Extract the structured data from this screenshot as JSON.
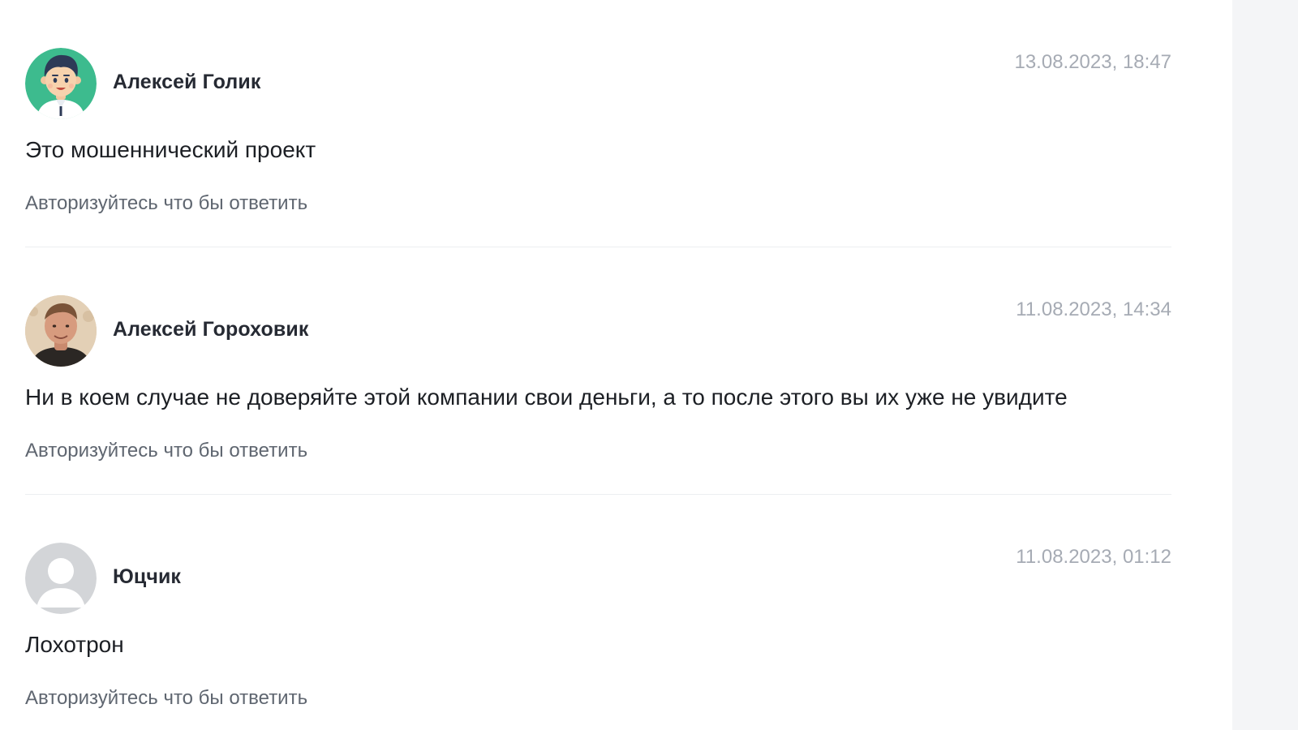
{
  "comments": [
    {
      "author": "Алексей Голик",
      "date": "13.08.2023, 18:47",
      "text": "Это мошеннический проект",
      "reply_label": "Авторизуйтесь что бы ответить",
      "avatar": "cartoon-businessman-avatar"
    },
    {
      "author": "Алексей Гороховик",
      "date": "11.08.2023, 14:34",
      "text": "Ни в коем случае не доверяйте этой компании свои деньги, а то после этого вы их уже не увидите",
      "reply_label": "Авторизуйтесь что бы ответить",
      "avatar": "user-photo-avatar"
    },
    {
      "author": "Юцчик",
      "date": "11.08.2023, 01:12",
      "text": "Лохотрон",
      "reply_label": "Авторизуйтесь что бы ответить",
      "avatar": "default-user-avatar"
    }
  ],
  "colors": {
    "author": "#262a33",
    "date": "#a6abb4",
    "text": "#1c1f24",
    "reply": "#5f6670",
    "divider": "#eceef1",
    "side_panel": "#f4f5f7",
    "avatar_green": "#3dbb8e"
  }
}
